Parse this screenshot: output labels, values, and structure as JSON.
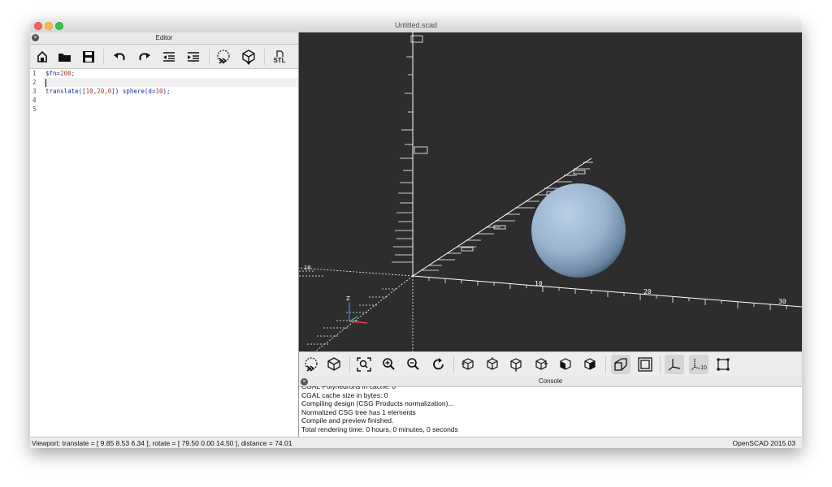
{
  "window": {
    "title": "Untitled.scad"
  },
  "editor": {
    "title": "Editor",
    "line_numbers": [
      "1",
      "2",
      "3",
      "4",
      "5"
    ],
    "code": {
      "line1_a": "$fn=",
      "line1_num": "200",
      "line1_b": ";",
      "line3_a": "translate([",
      "line3_n1": "10",
      "line3_c1": ",",
      "line3_n2": "20",
      "line3_c2": ",",
      "line3_n3": "0",
      "line3_b": "]) sphere(d=",
      "line3_n4": "10",
      "line3_e": ");"
    },
    "toolbar": {
      "stl_label": "STL"
    }
  },
  "viewport": {
    "axis_z_label": "Z",
    "tick_10": "10",
    "tick_20": "20",
    "tick_30": "30",
    "tick_10b": "10",
    "sphere_color": "#9ab4cf"
  },
  "viewport_toolbar": {
    "axes_label": "10"
  },
  "console": {
    "title": "Console",
    "lines": [
      "CGAL Polyhedrons in cache: 0",
      "CGAL cache size in bytes: 0",
      "Compiling design (CSG Products normalization)...",
      "Normalized CSG tree has 1 elements",
      "Compile and preview finished.",
      "Total rendering time: 0 hours, 0 minutes, 0 seconds"
    ]
  },
  "statusbar": {
    "viewport_info": "Viewport: translate = [ 9.85 8.53 6.34 ], rotate = [ 79.50 0.00 14.50 ], distance = 74.01",
    "version": "OpenSCAD 2015.03"
  }
}
